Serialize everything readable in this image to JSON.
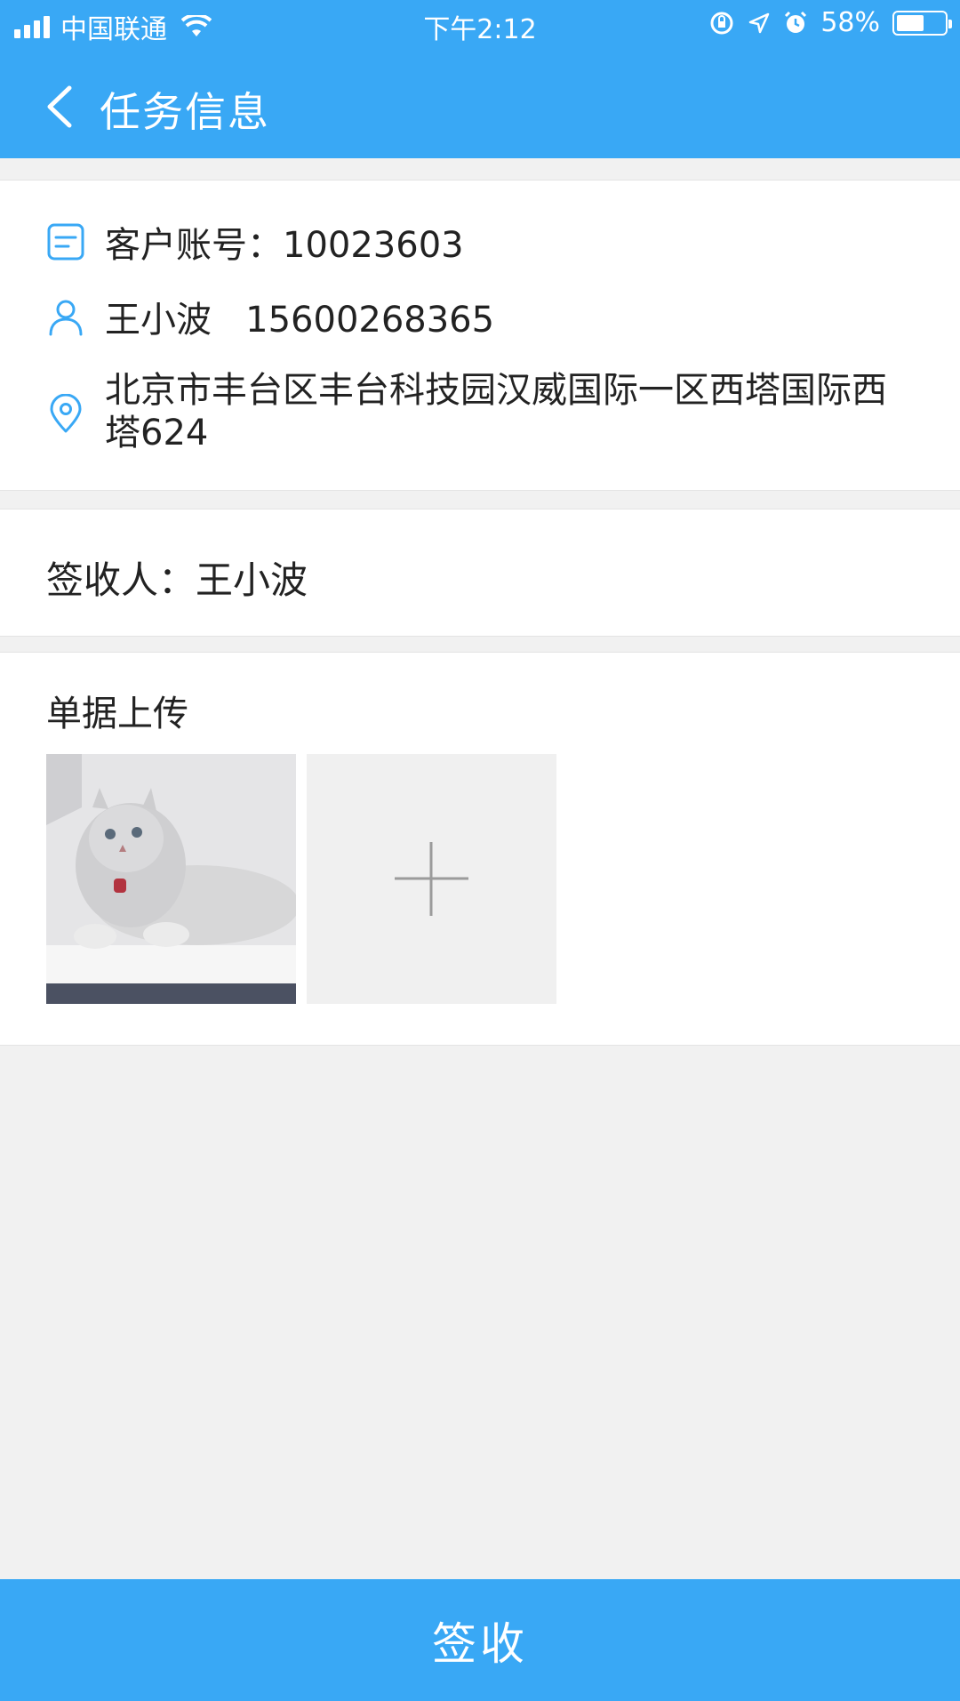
{
  "status_bar": {
    "carrier": "中国联通",
    "time": "下午2:12",
    "battery_percent": "58%",
    "battery_level": 0.58,
    "icons": [
      "signal-icon",
      "wifi-icon",
      "orientation-lock-icon",
      "location-icon",
      "alarm-icon",
      "battery-icon"
    ]
  },
  "nav": {
    "title": "任务信息",
    "back_icon": "chevron-left-icon"
  },
  "info": {
    "account_label": "客户账号：10023603",
    "contact": "王小波   15600268365",
    "address": "北京市丰台区丰台科技园汉威国际一区西塔国际西塔624",
    "icons": [
      "document-icon",
      "user-icon",
      "location-pin-icon"
    ]
  },
  "receiver": {
    "label": "签收人：王小波"
  },
  "upload": {
    "title": "单据上传",
    "add_icon": "plus-icon",
    "photo_count": 1
  },
  "actions": {
    "sign_label": "签收"
  },
  "colors": {
    "primary": "#39a8f5",
    "background": "#f1f1f1",
    "text": "#222222"
  }
}
